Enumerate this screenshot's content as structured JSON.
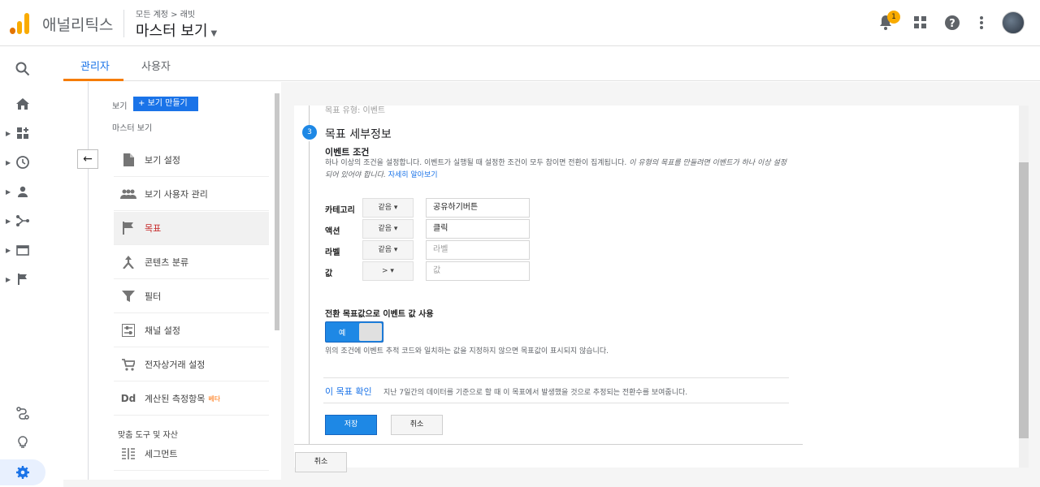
{
  "header": {
    "app_name": "애널리틱스",
    "breadcrumb": "모든 계정 > 래빗",
    "view_title": "마스터 보기",
    "notification_count": "1",
    "colors": {
      "logo_orange": "#f9ab00",
      "logo_dark": "#e37400",
      "accent": "#1a73e8"
    }
  },
  "tabs": [
    {
      "label": "관리자"
    },
    {
      "label": "사용자"
    }
  ],
  "admin": {
    "view_label": "보기",
    "create_view_label": "보기 만들기",
    "master_view_label": "마스터 보기",
    "items": [
      {
        "label": "보기 설정",
        "icon": "document-icon"
      },
      {
        "label": "보기 사용자 관리",
        "icon": "people-icon"
      },
      {
        "label": "목표",
        "icon": "flag-icon"
      },
      {
        "label": "콘텐츠 분류",
        "icon": "content-icon"
      },
      {
        "label": "필터",
        "icon": "filter-icon"
      },
      {
        "label": "채널 설정",
        "icon": "settings-sliders-icon"
      },
      {
        "label": "전자상거래 설정",
        "icon": "cart-icon"
      },
      {
        "label": "계산된 측정항목",
        "icon": "dd-icon",
        "badge": "베타"
      }
    ],
    "section_head": "맞춤 도구 및 자산",
    "segment_label": "세그먼트"
  },
  "goal": {
    "prev_step": "목표 유형: 이벤트",
    "step_number": "3",
    "step_title": "목표 세부정보",
    "condition_title": "이벤트 조건",
    "desc_main": "하나 이상의 조건을 설정합니다. 이벤트가 실행될 때 설정한 조건이 모두 참이면 전환이 집계됩니다. ",
    "desc_italic": "이 유형의 목표를 만들려면 이벤트가 하나 이상 설정되어 있어야 합니다.",
    "desc_link": " 자세히 알아보기",
    "conditions": [
      {
        "label": "카테고리",
        "operator": "같음 ▾",
        "value": "공유하기버튼",
        "placeholder": ""
      },
      {
        "label": "액션",
        "operator": "같음 ▾",
        "value": "클릭",
        "placeholder": ""
      },
      {
        "label": "라벨",
        "operator": "같음 ▾",
        "value": "",
        "placeholder": "라벨"
      },
      {
        "label": "값",
        "operator": "> ▾",
        "value": "",
        "placeholder": "값"
      }
    ],
    "toggle_title": "전환 목표값으로 이벤트 값 사용",
    "toggle_label": "예",
    "toggle_note": "위의 조건에 이벤트 추적 코드와 일치하는 값을 지정하지 않으면 목표값이 표시되지 않습니다.",
    "verify_label": "이 목표 확인",
    "verify_note": "지난 7일간의 데이터를 기준으로 할 때 이 목표에서 발생했을 것으로 추정되는 전환수를 보여줍니다.",
    "save_label": "저장",
    "cancel_label": "취소",
    "cancel_label_bottom": "취소"
  }
}
